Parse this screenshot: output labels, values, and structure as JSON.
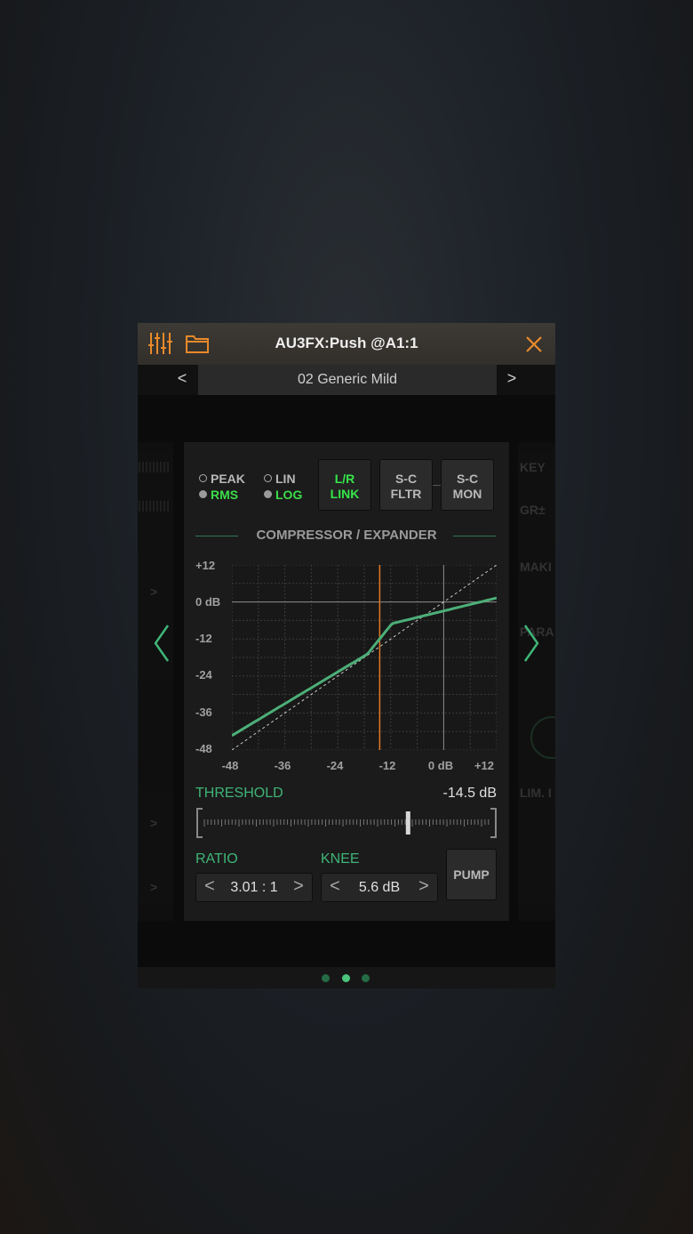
{
  "window": {
    "title": "AU3FX:Push @A1:1"
  },
  "preset": {
    "name": "02 Generic Mild",
    "prev": "<",
    "next": ">"
  },
  "detector": {
    "peak": "PEAK",
    "rms": "RMS",
    "lin": "LIN",
    "log": "LOG",
    "selected_mode": "RMS",
    "selected_scale": "LOG"
  },
  "buttons": {
    "lr_link": [
      "L/R",
      "LINK"
    ],
    "sc_fltr": [
      "S-C",
      "FLTR"
    ],
    "sc_mon": [
      "S-C",
      "MON"
    ],
    "pump": "PUMP"
  },
  "section_title": "COMPRESSOR / EXPANDER",
  "graph": {
    "y_labels": [
      "+12",
      "0 dB",
      "-12",
      "-24",
      "-36",
      "-48"
    ],
    "x_labels": [
      "-48",
      "-36",
      "-24",
      "-12",
      "0 dB",
      "+12"
    ],
    "threshold_db": -14.5,
    "ratio": 3.01,
    "knee_db": 5.6
  },
  "threshold": {
    "label": "THRESHOLD",
    "value": "-14.5 dB",
    "position": 0.715
  },
  "ratio": {
    "label": "RATIO",
    "value": "3.01 : 1"
  },
  "knee": {
    "label": "KNEE",
    "value": "5.6 dB"
  },
  "side_right": {
    "key": "KEY",
    "gr": "GR±",
    "make": "MAKI",
    "para": "PARA",
    "lim": "LIM. I"
  },
  "page_dots": {
    "count": 3,
    "active": 1
  },
  "colors": {
    "accent": "#e98a2a",
    "green": "#3fb577",
    "curve": "#4caf78",
    "threshold_line": "#e07a2a"
  }
}
